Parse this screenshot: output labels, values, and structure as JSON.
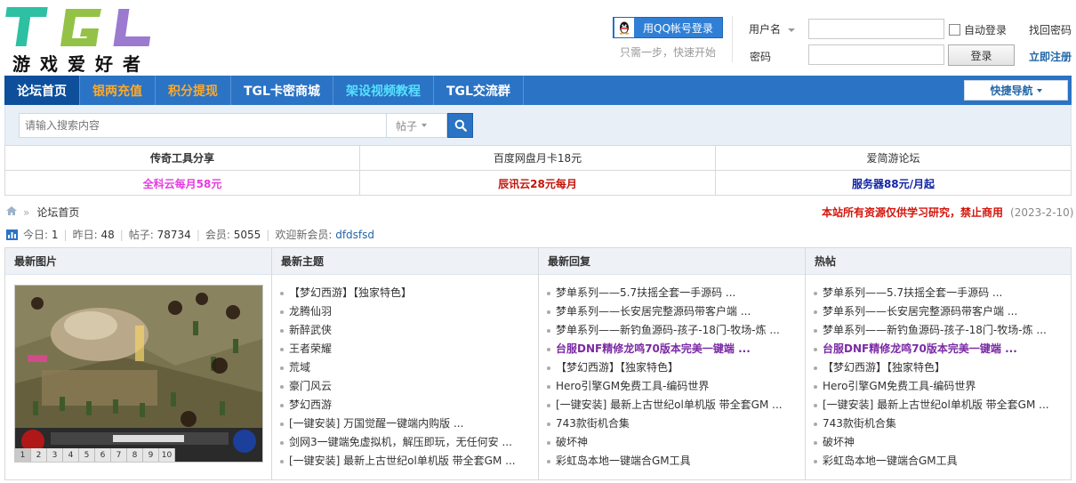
{
  "logo": {
    "letters": "TGL",
    "slogan": "游戏爱好者"
  },
  "login": {
    "qq_button": "用QQ帐号登录",
    "qq_tip": "只需一步，快速开始",
    "username_label": "用户名",
    "password_label": "密码",
    "auto_login": "自动登录",
    "login_button": "登录",
    "forgot_password": "找回密码",
    "register": "立即注册"
  },
  "nav": {
    "items": [
      {
        "label": "论坛首页",
        "color": "#ffffff"
      },
      {
        "label": "银两充值",
        "color": "#ffa928"
      },
      {
        "label": "积分提现",
        "color": "#ffa928"
      },
      {
        "label": "TGL卡密商城",
        "color": "#ffffff"
      },
      {
        "label": "架设视频教程",
        "color": "#55e0ff"
      },
      {
        "label": "TGL交流群",
        "color": "#ffffff"
      }
    ],
    "quick_nav": "快捷导航"
  },
  "search": {
    "placeholder": "请输入搜索内容",
    "type": "帖子"
  },
  "ads": [
    {
      "label": "传奇工具分享",
      "color": "#333333",
      "bold": true
    },
    {
      "label": "百度网盘月卡18元",
      "color": "#333333",
      "bold": false
    },
    {
      "label": "爱简游论坛",
      "color": "#333333",
      "bold": false
    },
    {
      "label": "全科云每月58元",
      "color": "#e53ce0",
      "bold": true
    },
    {
      "label": "辰讯云28元每月",
      "color": "#c4150c",
      "bold": true
    },
    {
      "label": "服务器88元/月起",
      "color": "#1124a6",
      "bold": true
    }
  ],
  "breadcrumb": {
    "home": "论坛首页"
  },
  "notice": {
    "text": "本站所有资源仅供学习研究，禁止商用",
    "date": "(2023-2-10)"
  },
  "stats": {
    "today_label": "今日:",
    "today": "1",
    "yesterday_label": "昨日:",
    "yesterday": "48",
    "posts_label": "帖子:",
    "posts": "78734",
    "members_label": "会员:",
    "members": "5055",
    "welcome_label": "欢迎新会员:",
    "new_member": "dfdsfsd"
  },
  "portal": {
    "images": {
      "title": "最新图片",
      "pages": [
        "1",
        "2",
        "3",
        "4",
        "5",
        "6",
        "7",
        "8",
        "9",
        "10"
      ]
    },
    "new_topics": {
      "title": "最新主题",
      "items": [
        {
          "text": "【梦幻西游】【独家特色】",
          "hl": false
        },
        {
          "text": "龙腾仙羽",
          "hl": false
        },
        {
          "text": "新醉武侠",
          "hl": false
        },
        {
          "text": "王者荣耀",
          "hl": false
        },
        {
          "text": "荒域",
          "hl": false
        },
        {
          "text": "豪门风云",
          "hl": false
        },
        {
          "text": "梦幻西游",
          "hl": false
        },
        {
          "text": "[一键安装] 万国觉醒一键端内购版 ...",
          "hl": false
        },
        {
          "text": "剑网3一键端免虚拟机，解压即玩，无任何安 ...",
          "hl": false
        },
        {
          "text": "[一键安装] 最新上古世纪ol单机版 带全套GM ...",
          "hl": false
        }
      ]
    },
    "new_replies": {
      "title": "最新回复",
      "items": [
        {
          "text": "梦单系列——5.7扶摇全套一手源码 ...",
          "hl": false
        },
        {
          "text": "梦单系列——长安居完整源码带客户端 ...",
          "hl": false
        },
        {
          "text": "梦单系列——新钓鱼源码-孩子-18门-牧场-炼 ...",
          "hl": false
        },
        {
          "text": "台服DNF精修龙鸣70版本完美一键端 ...",
          "hl": true
        },
        {
          "text": "【梦幻西游】【独家特色】",
          "hl": false
        },
        {
          "text": "Hero引擎GM免费工具-编码世界",
          "hl": false
        },
        {
          "text": "[一键安装] 最新上古世纪ol单机版 带全套GM ...",
          "hl": false
        },
        {
          "text": "743款街机合集",
          "hl": false
        },
        {
          "text": "破坏神",
          "hl": false
        },
        {
          "text": "彩虹岛本地一键端合GM工具",
          "hl": false
        }
      ]
    },
    "hot": {
      "title": "热帖",
      "items": [
        {
          "text": "梦单系列——5.7扶摇全套一手源码 ...",
          "hl": false
        },
        {
          "text": "梦单系列——长安居完整源码带客户端 ...",
          "hl": false
        },
        {
          "text": "梦单系列——新钓鱼源码-孩子-18门-牧场-炼 ...",
          "hl": false
        },
        {
          "text": "台服DNF精修龙鸣70版本完美一键端 ...",
          "hl": true
        },
        {
          "text": "【梦幻西游】【独家特色】",
          "hl": false
        },
        {
          "text": "Hero引擎GM免费工具-编码世界",
          "hl": false
        },
        {
          "text": "[一键安装] 最新上古世纪ol单机版 带全套GM ...",
          "hl": false
        },
        {
          "text": "743款街机合集",
          "hl": false
        },
        {
          "text": "破坏神",
          "hl": false
        },
        {
          "text": "彩虹岛本地一键端合GM工具",
          "hl": false
        }
      ]
    }
  }
}
